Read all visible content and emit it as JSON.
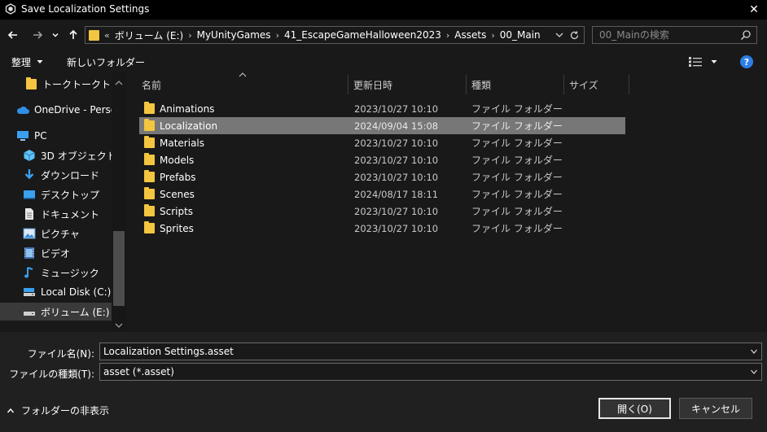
{
  "window": {
    "title": "Save Localization Settings",
    "close_label": "✕"
  },
  "address": {
    "prefix": "«",
    "crumbs": [
      "ボリューム (E:)",
      "MyUnityGames",
      "41_EscapeGameHalloween2023",
      "Assets",
      "00_Main"
    ]
  },
  "search": {
    "placeholder": "00_Mainの検索"
  },
  "toolbar": {
    "organize_label": "整理",
    "new_folder_label": "新しいフォルダー"
  },
  "navpane": {
    "items": [
      {
        "label": "トークトークトーク",
        "icon": "folder-icon"
      },
      {
        "label": "OneDrive - Persor",
        "icon": "cloud-icon"
      },
      {
        "label": "PC",
        "icon": "pc-icon"
      },
      {
        "label": "3D オブジェクト",
        "icon": "cube-icon"
      },
      {
        "label": "ダウンロード",
        "icon": "download-icon"
      },
      {
        "label": "デスクトップ",
        "icon": "desktop-icon"
      },
      {
        "label": "ドキュメント",
        "icon": "document-icon"
      },
      {
        "label": "ピクチャ",
        "icon": "picture-icon"
      },
      {
        "label": "ビデオ",
        "icon": "video-icon"
      },
      {
        "label": "ミュージック",
        "icon": "music-icon"
      },
      {
        "label": "Local Disk (C:)",
        "icon": "drive-icon"
      },
      {
        "label": "ボリューム (E:)",
        "icon": "drive-icon"
      }
    ]
  },
  "columns": {
    "name": "名前",
    "modified": "更新日時",
    "type": "種類",
    "size": "サイズ"
  },
  "files": [
    {
      "name": "Animations",
      "modified": "2023/10/27 10:10",
      "type": "ファイル フォルダー"
    },
    {
      "name": "Localization",
      "modified": "2024/09/04 15:08",
      "type": "ファイル フォルダー"
    },
    {
      "name": "Materials",
      "modified": "2023/10/27 10:10",
      "type": "ファイル フォルダー"
    },
    {
      "name": "Models",
      "modified": "2023/10/27 10:10",
      "type": "ファイル フォルダー"
    },
    {
      "name": "Prefabs",
      "modified": "2023/10/27 10:10",
      "type": "ファイル フォルダー"
    },
    {
      "name": "Scenes",
      "modified": "2024/08/17 18:11",
      "type": "ファイル フォルダー"
    },
    {
      "name": "Scripts",
      "modified": "2023/10/27 10:10",
      "type": "ファイル フォルダー"
    },
    {
      "name": "Sprites",
      "modified": "2023/10/27 10:10",
      "type": "ファイル フォルダー"
    }
  ],
  "form": {
    "filename_label": "ファイル名(N):",
    "filename_value": "Localization Settings.asset",
    "filetype_label": "ファイルの種類(T):",
    "filetype_value": "asset (*.asset)"
  },
  "footer": {
    "hide_folders_label": "フォルダーの非表示",
    "open_label": "開く(O)",
    "cancel_label": "キャンセル"
  },
  "colors": {
    "folder": "#f3c540",
    "selection": "#777777",
    "accent": "#2c7ee8"
  }
}
